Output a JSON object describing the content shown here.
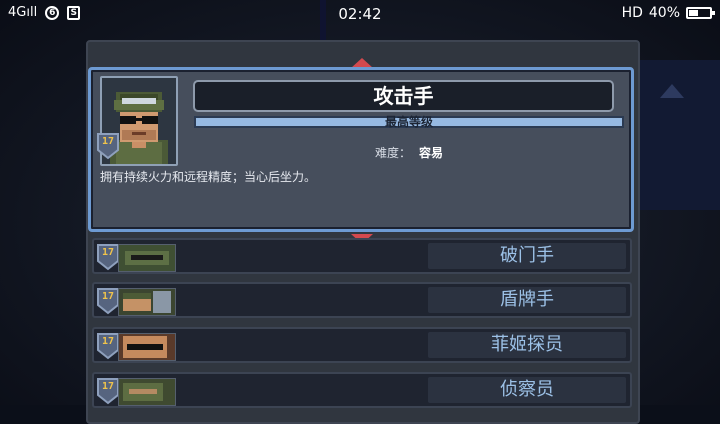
{
  "status_bar": {
    "network": "4G",
    "signal": "ıll",
    "icon_1": "6",
    "icon_2": "S",
    "time": "02:42",
    "hd": "HD",
    "battery": "40%"
  },
  "selected": {
    "name": "攻击手",
    "level": "17",
    "rank_label": "最高等级",
    "rank_fill": 1.0,
    "difficulty_label": "难度：",
    "difficulty_value": "容易",
    "description": "拥有持续火力和远程精度；当心后坐力。"
  },
  "list": [
    {
      "name": "破门手",
      "level": "17"
    },
    {
      "name": "盾牌手",
      "level": "17"
    },
    {
      "name": "菲姬探员",
      "level": "17"
    },
    {
      "name": "侦察员",
      "level": "17"
    }
  ],
  "colors": {
    "accent": "#6d9ad2",
    "arrow": "#d3494e",
    "level_badge": "#f0c34b",
    "list_text": "#9cc1e7"
  }
}
